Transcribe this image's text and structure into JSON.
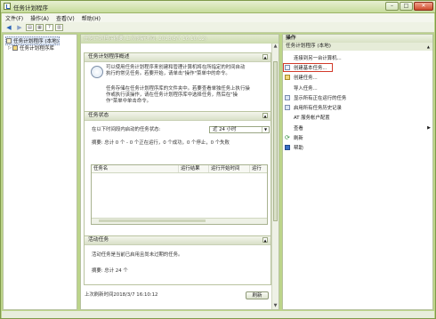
{
  "window": {
    "title": "任务计划程序"
  },
  "window_buttons": {
    "min": "–",
    "max": "□",
    "close": "✕"
  },
  "menubar": [
    "文件(F)",
    "操作(A)",
    "查看(V)",
    "帮助(H)"
  ],
  "tree": {
    "root": "任务计划程序 (本地)",
    "child": "任务计划程序库"
  },
  "center": {
    "header": "任务计划程序摘要(上次刷新时间: 2018/3/7 16:10:12)",
    "overview": {
      "title": "任务计划程序概述",
      "p1_line1": "可以使用任务计划程序来创建和管理计算机将在所指定的时间自动",
      "p1_line2": "执行的常见任务。若要开始，请单击\"操作\"菜单中的命令。",
      "p2_line1": "任务存储在任务计划程序库的文件夹中。若要查看单独任务上执行操",
      "p2_line2": "作或执行该操作，请在任务计划程序库中选择任务，然后在\"操",
      "p2_line3": "作\"菜单中单击命令。"
    },
    "status": {
      "title": "任务状态",
      "filter_label": "在以下时间段内启动的任务状态:",
      "filter_value": "近 24 小时",
      "summary": "摘要: 总计 0 个 - 0 个正在运行，0 个成功，0 个停止，0 个失败",
      "columns": [
        "任务名",
        "运行结果",
        "运行开始时间",
        "运行"
      ]
    },
    "active": {
      "title": "活动任务",
      "desc": "活动任务是当前已启用且尚未过期的任务。",
      "summary": "摘要: 总计 24 个"
    },
    "footer": {
      "last_refresh": "上次刷新时间2018/3/7 16:10:12",
      "refresh_button": "刷新"
    }
  },
  "actions": {
    "header": "操作",
    "group": "任务计划程序 (本地)",
    "items": [
      "连接到另一台计算机...",
      "创建基本任务...",
      "创建任务...",
      "导入任务...",
      "显示所有正在运行的任务",
      "启用所有任务历史记录",
      "AT 服务帐户配置",
      "查看",
      "刷新",
      "帮助"
    ]
  }
}
